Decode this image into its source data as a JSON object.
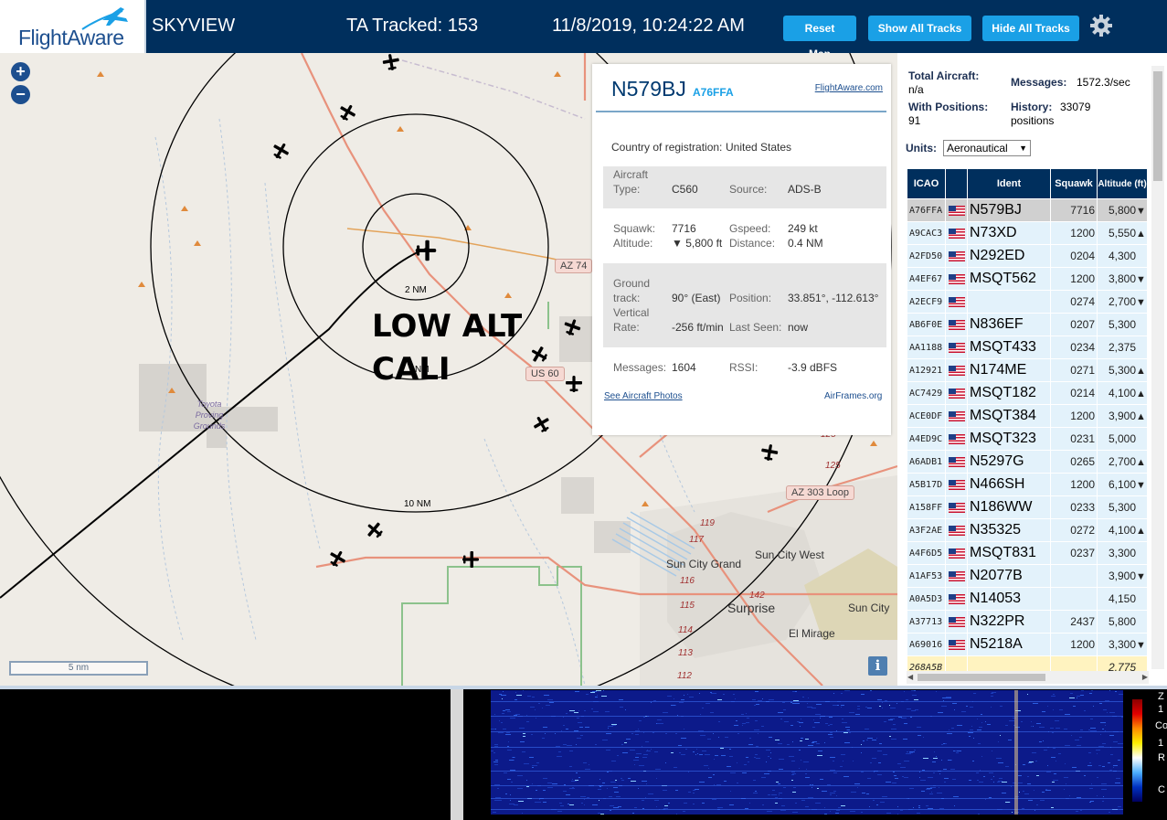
{
  "header": {
    "logo_text": "FlightAware",
    "app_title": "SKYVIEW",
    "tracked": "TA Tracked: 153",
    "datetime": "11/8/2019, 10:24:22 AM",
    "buttons": {
      "reset_map": "Reset Map",
      "show_all_tracks": "Show All Tracks",
      "hide_all_tracks": "Hide All Tracks"
    },
    "settings_icon": "gear-icon"
  },
  "map": {
    "zoom_in": "+",
    "zoom_out": "−",
    "scale_label": "5 nm",
    "info_label": "i",
    "overlay_line1": "LOW ALT",
    "overlay_line2": "CALI",
    "ring_labels": [
      "2 NM",
      "NM",
      "10 NM"
    ],
    "road_labels": [
      "AZ 74",
      "US 60",
      "AZ 303 Loop"
    ],
    "place_labels": [
      "Sun City Grand",
      "Sun City West",
      "Surprise",
      "Sun City",
      "El Mirage"
    ],
    "proving_grounds": "Toyota Proving Grounds",
    "highway_numbers": [
      "125",
      "125",
      "119",
      "117",
      "116",
      "115",
      "114",
      "113",
      "112",
      "142"
    ]
  },
  "selected": {
    "callsign": "N579BJ",
    "icao": "A76FFA",
    "fa_link": "FlightAware.com",
    "country_label": "Country of registration:",
    "country": "United States",
    "aircraft_type_label": "Aircraft Type:",
    "aircraft_type_label_1": "Aircraft",
    "aircraft_type_label_2": "Type:",
    "aircraft_type": "C560",
    "source_label": "Source:",
    "source": "ADS-B",
    "squawk_label": "Squawk:",
    "squawk": "7716",
    "gspeed_label": "Gspeed:",
    "gspeed": "249 kt",
    "altitude_label": "Altitude:",
    "altitude": "▼ 5,800 ft",
    "distance_label": "Distance:",
    "distance": "0.4 NM",
    "ground_track_label_1": "Ground",
    "ground_track_label_2": "track:",
    "ground_track": "90° (East)",
    "position_label": "Position:",
    "position": "33.851°, -112.613°",
    "vrate_label_1": "Vertical",
    "vrate_label_2": "Rate:",
    "vrate": "-256 ft/min",
    "last_seen_label": "Last Seen:",
    "last_seen": "now",
    "messages_label": "Messages:",
    "messages": "1604",
    "rssi_label": "RSSI:",
    "rssi": "-3.9 dBFS",
    "photos_link": "See Aircraft Photos",
    "airframes_link": "AirFrames.org"
  },
  "sidebar": {
    "total_aircraft_label": "Total Aircraft:",
    "total_aircraft": "n/a",
    "messages_label": "Messages:",
    "messages": "1572.3/sec",
    "with_positions_label": "With Positions:",
    "with_positions": "91",
    "history_label": "History:",
    "history": "33079",
    "history_unit": "positions",
    "units_label": "Units:",
    "units_value": "Aeronautical",
    "table_headers": [
      "ICAO",
      "",
      "Ident",
      "Squawk",
      "Altitude (ft)"
    ],
    "rows": [
      {
        "icao": "A76FFA",
        "ident": "N579BJ",
        "squawk": "7716",
        "alt": "5,800",
        "trend": "▼"
      },
      {
        "icao": "A9CAC3",
        "ident": "N73XD",
        "squawk": "1200",
        "alt": "5,550",
        "trend": "▲"
      },
      {
        "icao": "A2FD50",
        "ident": "N292ED",
        "squawk": "0204",
        "alt": "4,300",
        "trend": ""
      },
      {
        "icao": "A4EF67",
        "ident": "MSQT562",
        "squawk": "1200",
        "alt": "3,800",
        "trend": "▼"
      },
      {
        "icao": "A2ECF9",
        "ident": "",
        "squawk": "0274",
        "alt": "2,700",
        "trend": "▼"
      },
      {
        "icao": "AB6F0E",
        "ident": "N836EF",
        "squawk": "0207",
        "alt": "5,300",
        "trend": ""
      },
      {
        "icao": "AA1188",
        "ident": "MSQT433",
        "squawk": "0234",
        "alt": "2,375",
        "trend": ""
      },
      {
        "icao": "A12921",
        "ident": "N174ME",
        "squawk": "0271",
        "alt": "5,300",
        "trend": "▲"
      },
      {
        "icao": "AC7429",
        "ident": "MSQT182",
        "squawk": "0214",
        "alt": "4,100",
        "trend": "▲"
      },
      {
        "icao": "ACE0DF",
        "ident": "MSQT384",
        "squawk": "1200",
        "alt": "3,900",
        "trend": "▲"
      },
      {
        "icao": "A4ED9C",
        "ident": "MSQT323",
        "squawk": "0231",
        "alt": "5,000",
        "trend": ""
      },
      {
        "icao": "A6ADB1",
        "ident": "N5297G",
        "squawk": "0265",
        "alt": "2,700",
        "trend": "▲"
      },
      {
        "icao": "A5B17D",
        "ident": "N466SH",
        "squawk": "1200",
        "alt": "6,100",
        "trend": "▼"
      },
      {
        "icao": "A158FF",
        "ident": "N186WW",
        "squawk": "0233",
        "alt": "5,300",
        "trend": ""
      },
      {
        "icao": "A3F2AE",
        "ident": "N35325",
        "squawk": "0272",
        "alt": "4,100",
        "trend": "▲"
      },
      {
        "icao": "A4F6D5",
        "ident": "MSQT831",
        "squawk": "0237",
        "alt": "3,300",
        "trend": ""
      },
      {
        "icao": "A1AF53",
        "ident": "N2077B",
        "squawk": "",
        "alt": "3,900",
        "trend": "▼"
      },
      {
        "icao": "A0A5D3",
        "ident": "N14053",
        "squawk": "",
        "alt": "4,150",
        "trend": ""
      },
      {
        "icao": "A37713",
        "ident": "N322PR",
        "squawk": "2437",
        "alt": "5,800",
        "trend": ""
      },
      {
        "icao": "A69016",
        "ident": "N5218A",
        "squawk": "1200",
        "alt": "3,300",
        "trend": "▼"
      },
      {
        "icao": "268A5B",
        "ident": "",
        "squawk": "",
        "alt": "2,775",
        "trend": ""
      }
    ]
  },
  "bottom": {
    "right_text": [
      "Z",
      "1",
      "Co",
      "1",
      "R",
      "",
      "C",
      ""
    ]
  },
  "colors": {
    "header_bg": "#002f5d",
    "button_bg": "#1aa0e6",
    "table_header_bg": "#002f5d",
    "row_bg": "#e3f2fb",
    "selected_row_bg": "#d0d0d0",
    "emergency_row_bg": "#fff3c0"
  }
}
